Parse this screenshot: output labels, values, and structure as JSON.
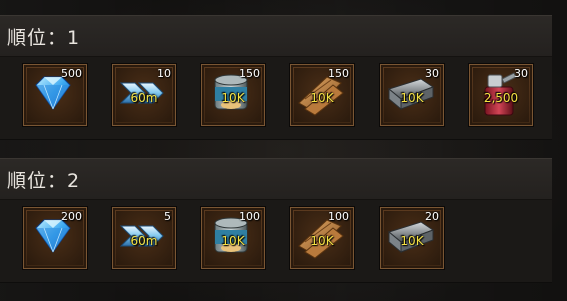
{
  "sections": [
    {
      "title": "順位：1",
      "items": [
        {
          "icon": "diamond-icon",
          "count": "500",
          "amount": ""
        },
        {
          "icon": "speedup-icon",
          "count": "10",
          "amount": "60m"
        },
        {
          "icon": "food-can-icon",
          "count": "150",
          "amount": "10K"
        },
        {
          "icon": "wood-planks-icon",
          "count": "150",
          "amount": "10K"
        },
        {
          "icon": "iron-ingot-icon",
          "count": "30",
          "amount": "10K"
        },
        {
          "icon": "oil-canister-icon",
          "count": "30",
          "amount": "2,500"
        }
      ]
    },
    {
      "title": "順位：2",
      "items": [
        {
          "icon": "diamond-icon",
          "count": "200",
          "amount": ""
        },
        {
          "icon": "speedup-icon",
          "count": "5",
          "amount": "60m"
        },
        {
          "icon": "food-can-icon",
          "count": "100",
          "amount": "10K"
        },
        {
          "icon": "wood-planks-icon",
          "count": "100",
          "amount": "10K"
        },
        {
          "icon": "iron-ingot-icon",
          "count": "20",
          "amount": "10K"
        }
      ]
    }
  ]
}
